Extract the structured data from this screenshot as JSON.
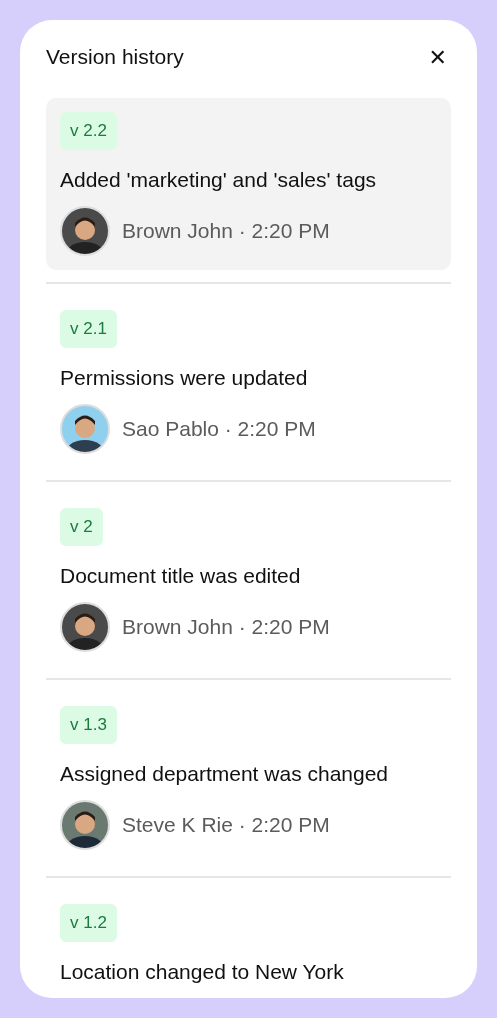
{
  "panel": {
    "title": "Version history",
    "close": "✕"
  },
  "versions": [
    {
      "version": "v 2.2",
      "title": "Added 'marketing' and 'sales' tags",
      "meta": "Brown John · 2:20 PM",
      "selected": true
    },
    {
      "version": "v 2.1",
      "title": "Permissions were updated",
      "meta": "Sao Pablo · 2:20 PM",
      "selected": false
    },
    {
      "version": "v 2",
      "title": "Document title was edited",
      "meta": "Brown John · 2:20 PM",
      "selected": false
    },
    {
      "version": "v 1.3",
      "title": "Assigned department was changed",
      "meta": "Steve K Rie · 2:20 PM",
      "selected": false
    },
    {
      "version": "v 1.2",
      "title": "Location changed to New York",
      "selected": false
    }
  ]
}
